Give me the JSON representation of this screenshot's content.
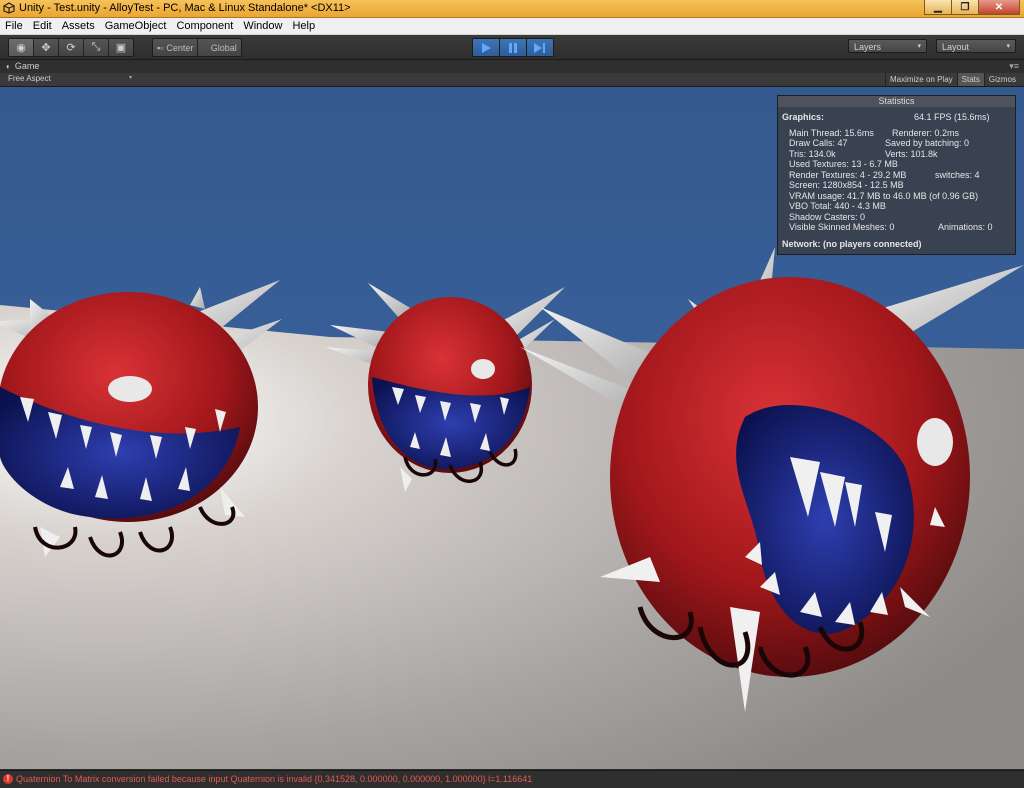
{
  "window": {
    "title": "Unity - Test.unity - AlloyTest - PC, Mac & Linux Standalone* <DX11>",
    "controls": {
      "minimize": "▁",
      "maximize": "❐",
      "close": "✕"
    }
  },
  "menu": [
    "File",
    "Edit",
    "Assets",
    "GameObject",
    "Component",
    "Window",
    "Help"
  ],
  "toolbar": {
    "tools": [
      {
        "icon": "eye-icon",
        "glyph": "◉"
      },
      {
        "icon": "move-icon",
        "glyph": "✥"
      },
      {
        "icon": "rotate-icon",
        "glyph": "⟳"
      },
      {
        "icon": "scale-icon",
        "glyph": "⤡"
      },
      {
        "icon": "rect-icon",
        "glyph": "▣"
      }
    ],
    "pivot": "Center",
    "space": "Global",
    "layers": "Layers",
    "layout": "Layout",
    "dropdown_arrow": "▾",
    "play_state": "playing"
  },
  "game_panel": {
    "tab": "Game",
    "aspect": "Free Aspect",
    "buttons": [
      "Maximize on Play",
      "Stats",
      "Gizmos"
    ],
    "menu_glyph": "▾≡"
  },
  "stats": {
    "title": "Statistics",
    "graphics_label": "Graphics:",
    "fps": "64.1 FPS (15.6ms)",
    "main_thread": "Main Thread: 15.6ms",
    "renderer": "Renderer: 0.2ms",
    "draw_calls": "Draw Calls: 47",
    "batching": "Saved by batching: 0",
    "tris": "Tris: 134.0k",
    "verts": "Verts: 101.8k",
    "used_textures": "Used Textures: 13 - 6.7 MB",
    "render_textures": "Render Textures: 4 - 29.2 MB",
    "switches": "switches: 4",
    "screen": "Screen: 1280x854 - 12.5 MB",
    "vram": "VRAM usage: 41.7 MB to 46.0 MB (of 0.96 GB)",
    "vbo": "VBO Total: 440 - 4.3 MB",
    "shadow_casters": "Shadow Casters: 0",
    "skinned": "Visible Skinned Meshes: 0",
    "animations": "Animations: 0",
    "network": "Network: (no players connected)"
  },
  "status": {
    "icon": "!",
    "message": "Quaternion To Matrix conversion failed because input Quaternion is invalid {0.341528, 0.000000, 0.000000, 1.000000} l=1.116641"
  },
  "colors": {
    "sky": "#34598f",
    "monster_red": "#a5191c",
    "monster_blue": "#1a2a86",
    "spike": "#dcdcdc",
    "unity_bg": "#2b2b2b"
  }
}
